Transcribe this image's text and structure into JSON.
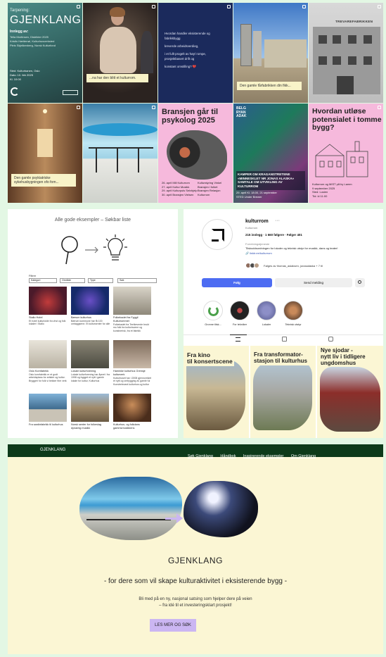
{
  "grid": {
    "t1": {
      "kicker": "Tarpening:",
      "title": "GJENKLANG",
      "innlegg_label": "Innlegg av:",
      "lines": [
        "Tella Mortinsen, Distrikter 2025",
        "Kristin Hætterrøl, Kulturhusverksted",
        "Pleis Skjelkenberg, Norsk Kulturfond"
      ],
      "when": [
        "Sted: Kulturbanen, Oslo",
        "Dato: 10. feb 2025",
        "Kl. 10:00"
      ]
    },
    "t2": {
      "caption": "...na har den blitt et kulturrom."
    },
    "t3": {
      "lines": [
        "Hvordan handler eksisterende og",
        "fabrikkbygg",
        "kreverde arbeidsverdieg,",
        "i et fullt progelt av høy/ rompe,",
        "prosjektbasert drift og",
        "konstant omstilling? 💔"
      ]
    },
    "t4": {
      "caption": "Den gamle fårfabrikken din fikk..."
    },
    "t5": {
      "sign": "TREVAREFABRIKKEN"
    },
    "t6": {
      "caption": "Den gamle psykiatriske sykehusbygningen ofo fom..."
    },
    "t8": {
      "title": [
        "Bransjen går til",
        "psykolog 2025"
      ],
      "rows": [
        "26. april  Mill Kulturrom",
        "27. april  Kultur Musikk",
        "29. april  Kulturpuls Selvhjelp",
        "30. april  Bransjen Vielsen"
      ],
      "rows2": [
        "Kulturstyring Vinkel",
        "Bransjen i folket",
        "Bransjen Relasjon",
        "Kulturrom"
      ]
    },
    "t9": {
      "top": [
        "BELG",
        "RYAN",
        "ADAK"
      ],
      "headline": "KAMPER OM KRAGANSTRETENE «MINNESKLET NR JONAS ALASKA» SAMTALE OM UTVIKLING AV KULTURROM",
      "meta": [
        "29. april  Kl. 18.00, 21 september",
        "STED  Under Brewer"
      ]
    },
    "t10": {
      "title": [
        "Hvordan utløse",
        "potensialet i tomme",
        "bygg?"
      ],
      "meta": [
        "Kulturrom og MIST på by Lamm",
        "9 september 2025",
        "Sted: Lusien",
        "Tid: kl 11:00"
      ]
    }
  },
  "example_list": {
    "title": "Alle gode eksempler – Søkbar liste",
    "filters_label": "Filtrer",
    "filters": [
      "Kategori",
      "Område",
      "Type",
      "Søk"
    ],
    "items": [
      {
        "title": "Stallo Hotel",
        "desc": "Et hotel kulturlokle fra vhst og folk lokaler i Stallo"
      },
      {
        "title": "Bærum kulturhus",
        "desc": "Bærum kommune har få 100 omtaggsene. Et kultursenter for alle"
      },
      {
        "title": "Folkebadet fra Fyggil Kulturrommet",
        "desc": "Folkebadet fra Teelkeverde brukt mo folk fra kultur/scene og kunstnerisk, fra et fabrikk"
      },
      {
        "title": "Oslo Kornfabrikk",
        "desc": "Oslo kornfabrikk er et godt arbeidsplass for artister og kultur. Bryggeri for folk vi bekker fine verk"
      },
      {
        "title": "Lokale kulturforening",
        "desc": "Lokale kulturforening har åpnet i fra 1998 og bygget et nytt i gamle lokale for kultur, Kulturhus"
      },
      {
        "title": "Haminke kulturhus Grensje kulturverk",
        "desc": "Kulturhuset har i 2008 gjennomført et nytt og ombygging av gamle ful Kunstrelevant kulturhus og kultur"
      },
      {
        "title": "Fra sardinfabrikk til kulturhus",
        "desc": ""
      },
      {
        "title": "Norsk senter for folkeslag dynamig musikk",
        "desc": ""
      },
      {
        "title": "Kulturhus- og folkdans gammsmusikkens",
        "desc": ""
      }
    ]
  },
  "instagram": {
    "username": "kulturrom",
    "more": "···",
    "category": "Kulturrom",
    "stats": "215 innlegg · 1 660 følgere · Følger 401",
    "type": "Forretningstjeneste",
    "bio": "Tilskuddsordningen for lokaler og teknisk utstyr for musikk, dans og teater!",
    "link": "linktr.ee/kulturrom",
    "followed_by": "Følges av thomas_aslaksen, jonasalaska + 7 til",
    "follow_button": "Følg",
    "message_button": "Send melding",
    "highlights": [
      "Gronne tilsk...",
      "For tekniker",
      "Lokaler",
      "Teknisk utstyr"
    ],
    "posts": [
      [
        "Fra kino",
        "til konsertscene"
      ],
      [
        "Fra transformator-",
        "stasjon til kulturhus"
      ],
      [
        "Nye sjodar -",
        "nytt liv i tidligere",
        "ungdomshus"
      ]
    ]
  },
  "site": {
    "brand": "GJENKLANG",
    "nav": [
      "Søk Gjenklang",
      "Håndbok",
      "Inspirerende eksempler",
      "Om Gjenklang"
    ],
    "title": "GJENKLANG",
    "subtitle": "- for dere som vil skape kulturaktivitet i eksisterende bygg -",
    "body": [
      "Bli med på en ny, nasjonal satsing som hjelper dere på veien",
      "– fra idé til et investeringsklart prosjekt!"
    ],
    "cta": "LES MER OG SØK"
  },
  "colors": {
    "background": "#e3f7e4",
    "pink": "#f6b9dc",
    "navy": "#1b2a5c",
    "cream": "#fbf6d4",
    "lavender": "#cbb6f2",
    "site_bar": "#0d3a1a",
    "follow_blue": "#4d6cf2"
  }
}
